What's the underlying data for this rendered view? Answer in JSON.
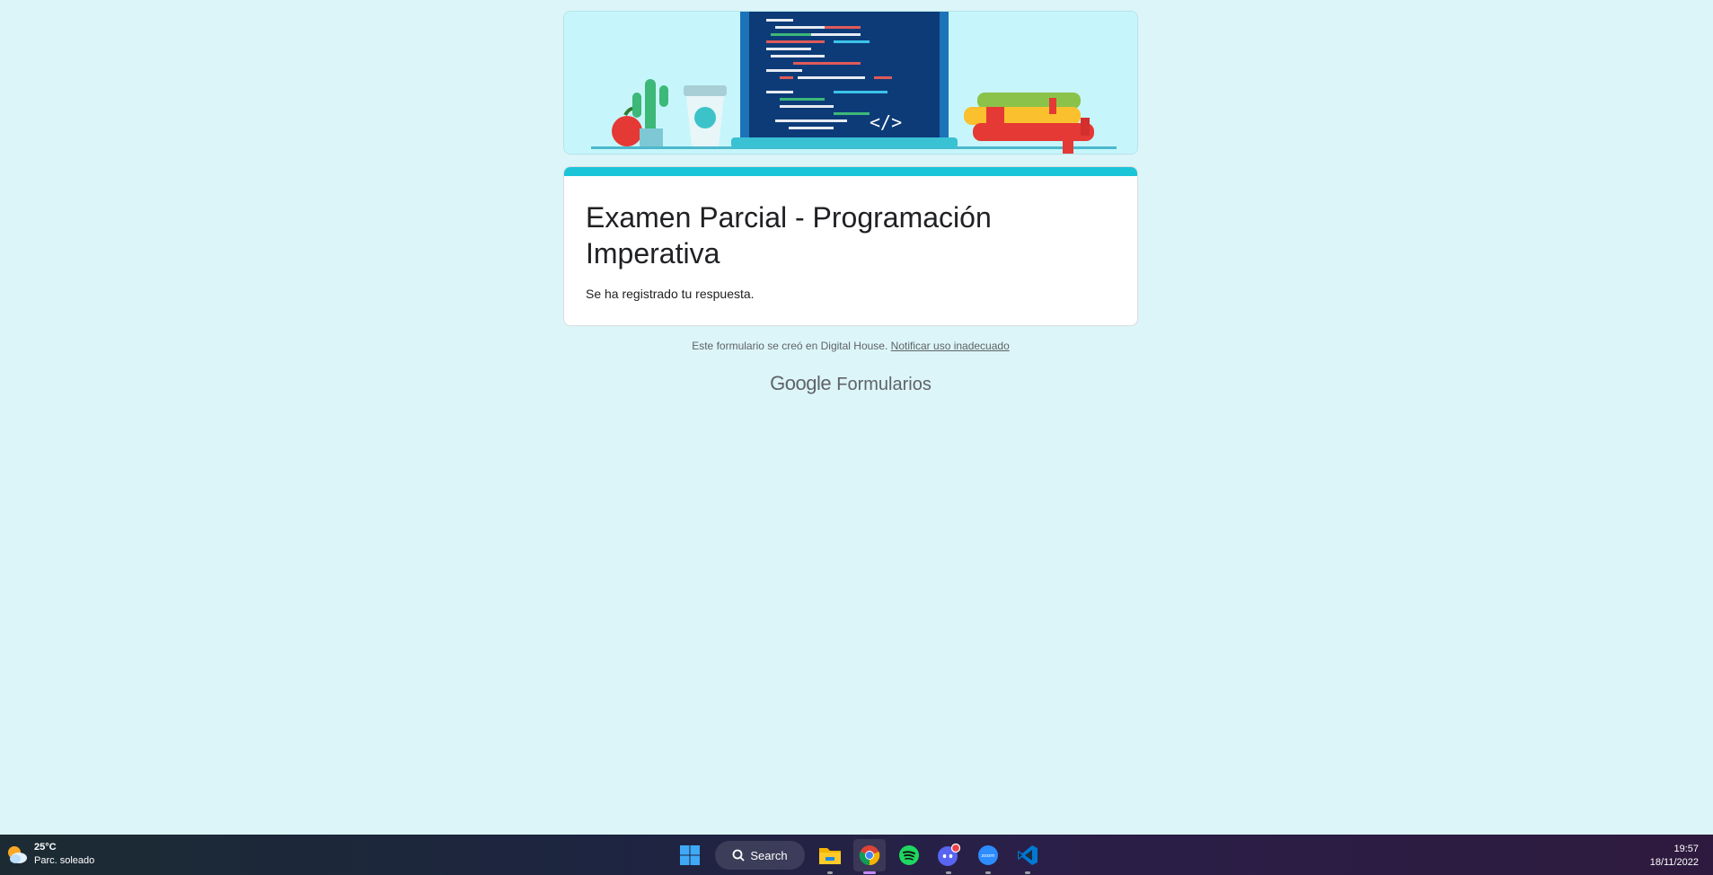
{
  "form": {
    "title": "Examen Parcial - Programación Imperativa",
    "confirmation": "Se ha registrado tu respuesta."
  },
  "footer": {
    "note": "Este formulario se creó en Digital House.",
    "report_link": "Notificar uso inadecuado",
    "brand_google": "Google",
    "brand_product": "Formularios"
  },
  "colors": {
    "background": "#dcf5f8",
    "accent": "#1cc4d8"
  },
  "taskbar": {
    "weather": {
      "temperature": "25°C",
      "condition": "Parc. soleado",
      "icon": "partly-sunny-icon"
    },
    "search_label": "Search",
    "apps": [
      {
        "name": "start",
        "icon": "windows-logo-icon"
      },
      {
        "name": "file-explorer",
        "icon": "folder-icon"
      },
      {
        "name": "chrome",
        "icon": "chrome-icon"
      },
      {
        "name": "spotify",
        "icon": "spotify-icon"
      },
      {
        "name": "discord",
        "icon": "discord-icon"
      },
      {
        "name": "zoom",
        "icon": "zoom-icon",
        "label": "zoom"
      },
      {
        "name": "vscode",
        "icon": "vscode-icon"
      }
    ],
    "time": "19:57",
    "date": "18/11/2022"
  }
}
